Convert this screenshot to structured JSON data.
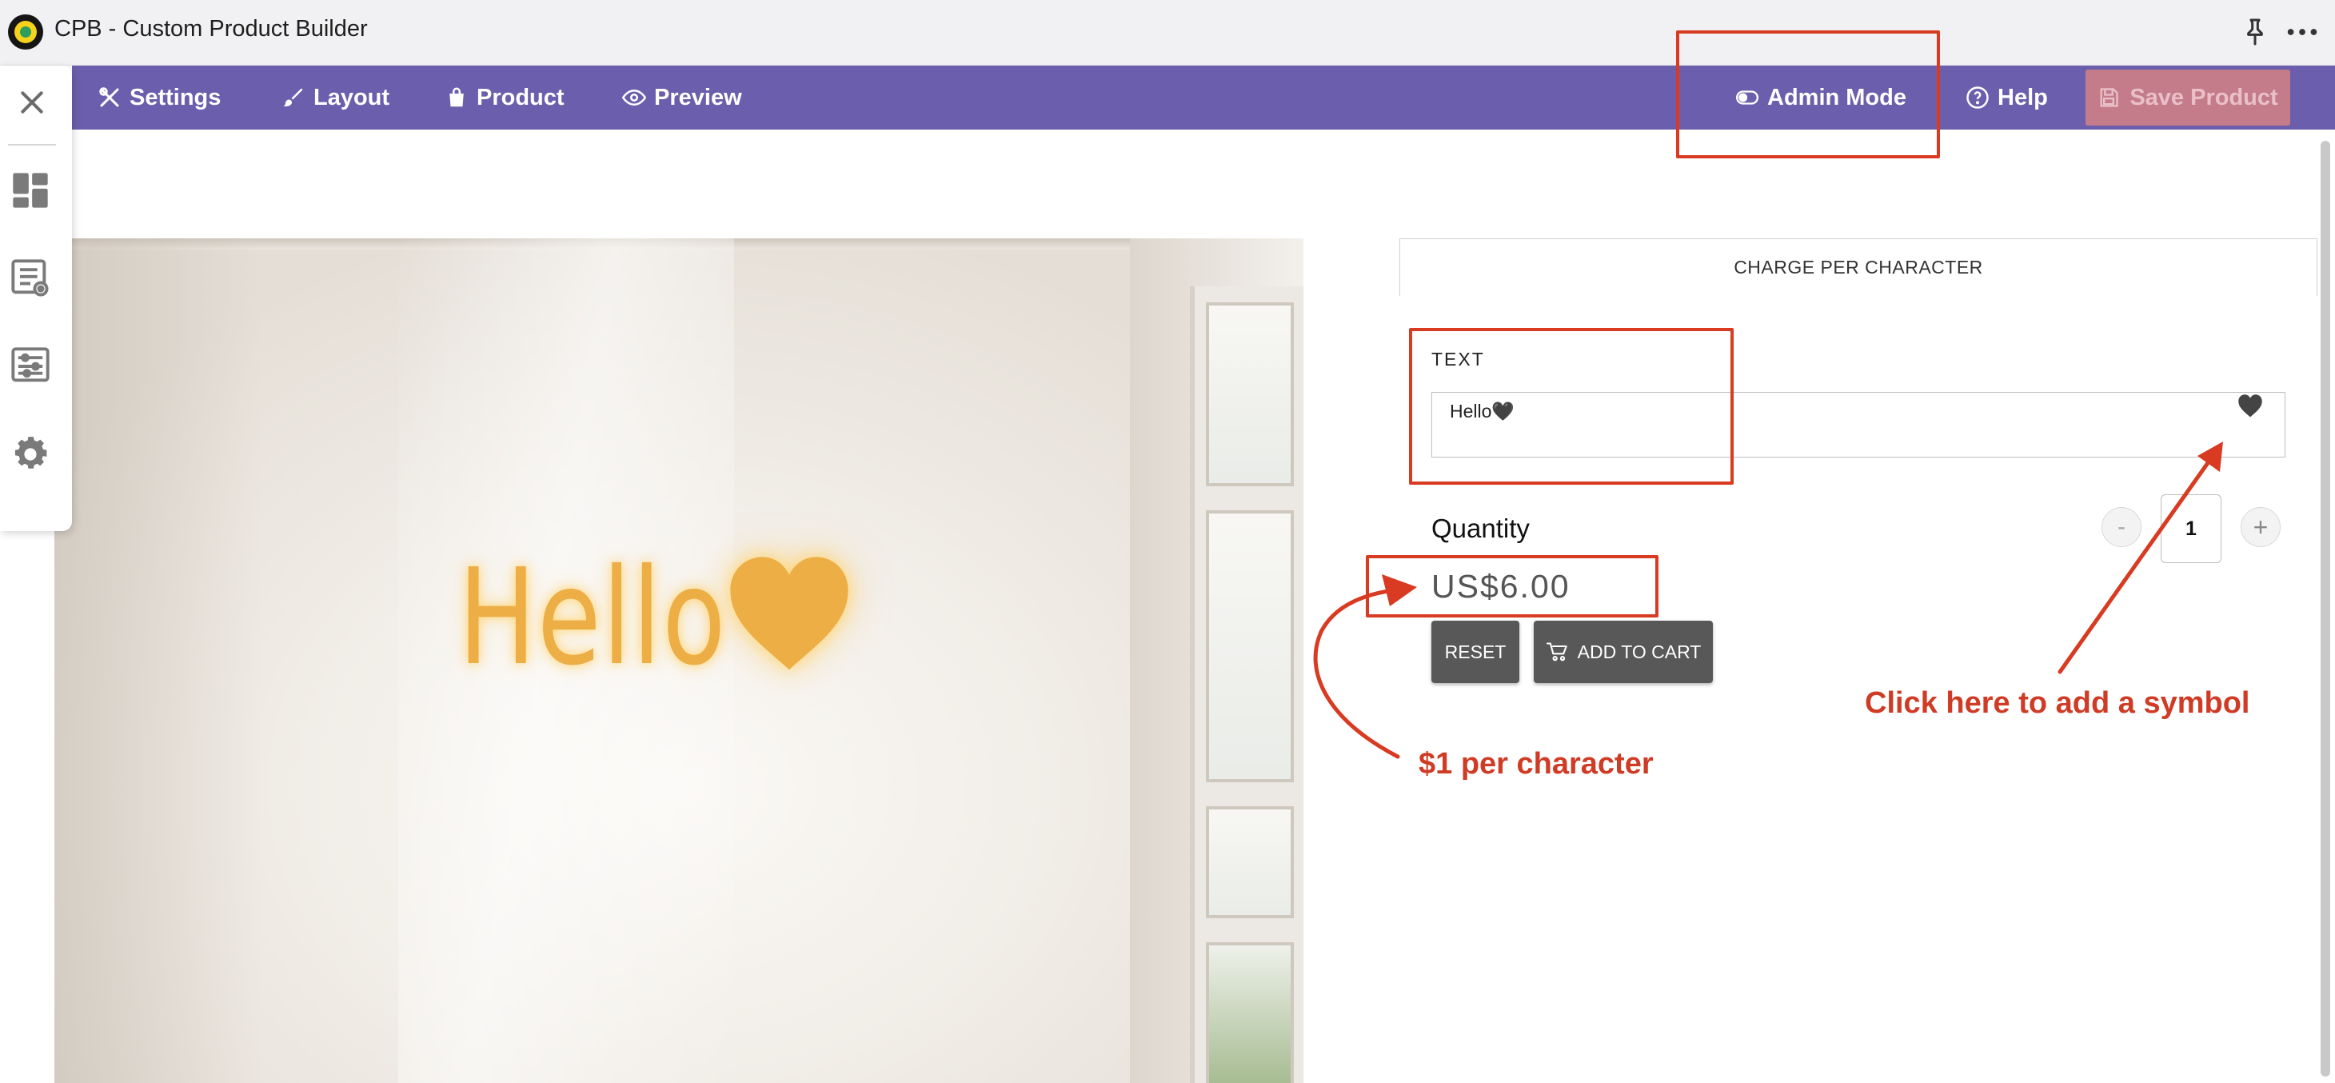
{
  "window": {
    "title": "CPB - Custom Product Builder"
  },
  "nav": {
    "settings": "Settings",
    "layout": "Layout",
    "product": "Product",
    "preview": "Preview",
    "admin_mode": "Admin Mode",
    "help": "Help",
    "save_product": "Save Product"
  },
  "sidebar": {
    "items": [
      {
        "icon": "close-icon"
      },
      {
        "icon": "dashboard-icon"
      },
      {
        "icon": "list-settings-icon"
      },
      {
        "icon": "sliders-icon"
      },
      {
        "icon": "gear-icon"
      }
    ]
  },
  "preview": {
    "text": "Hello"
  },
  "panel": {
    "tab_label": "CHARGE PER CHARACTER",
    "text_label": "TEXT",
    "text_value": "Hello🖤",
    "symbol_glyph": "🖤",
    "quantity_label": "Quantity",
    "qty_minus": "-",
    "quantity_value": "1",
    "qty_plus": "+",
    "price": "US$6.00",
    "reset_label": "RESET",
    "add_to_cart_label": "ADD TO CART"
  },
  "annotations": {
    "per_char": "$1 per character",
    "symbol_hint": "Click here to add a symbol"
  },
  "colors": {
    "nav_bg": "#6b5fad",
    "save_btn": "#c47c8a",
    "annotation": "#d83a22",
    "neon_text": "#ecae45"
  }
}
